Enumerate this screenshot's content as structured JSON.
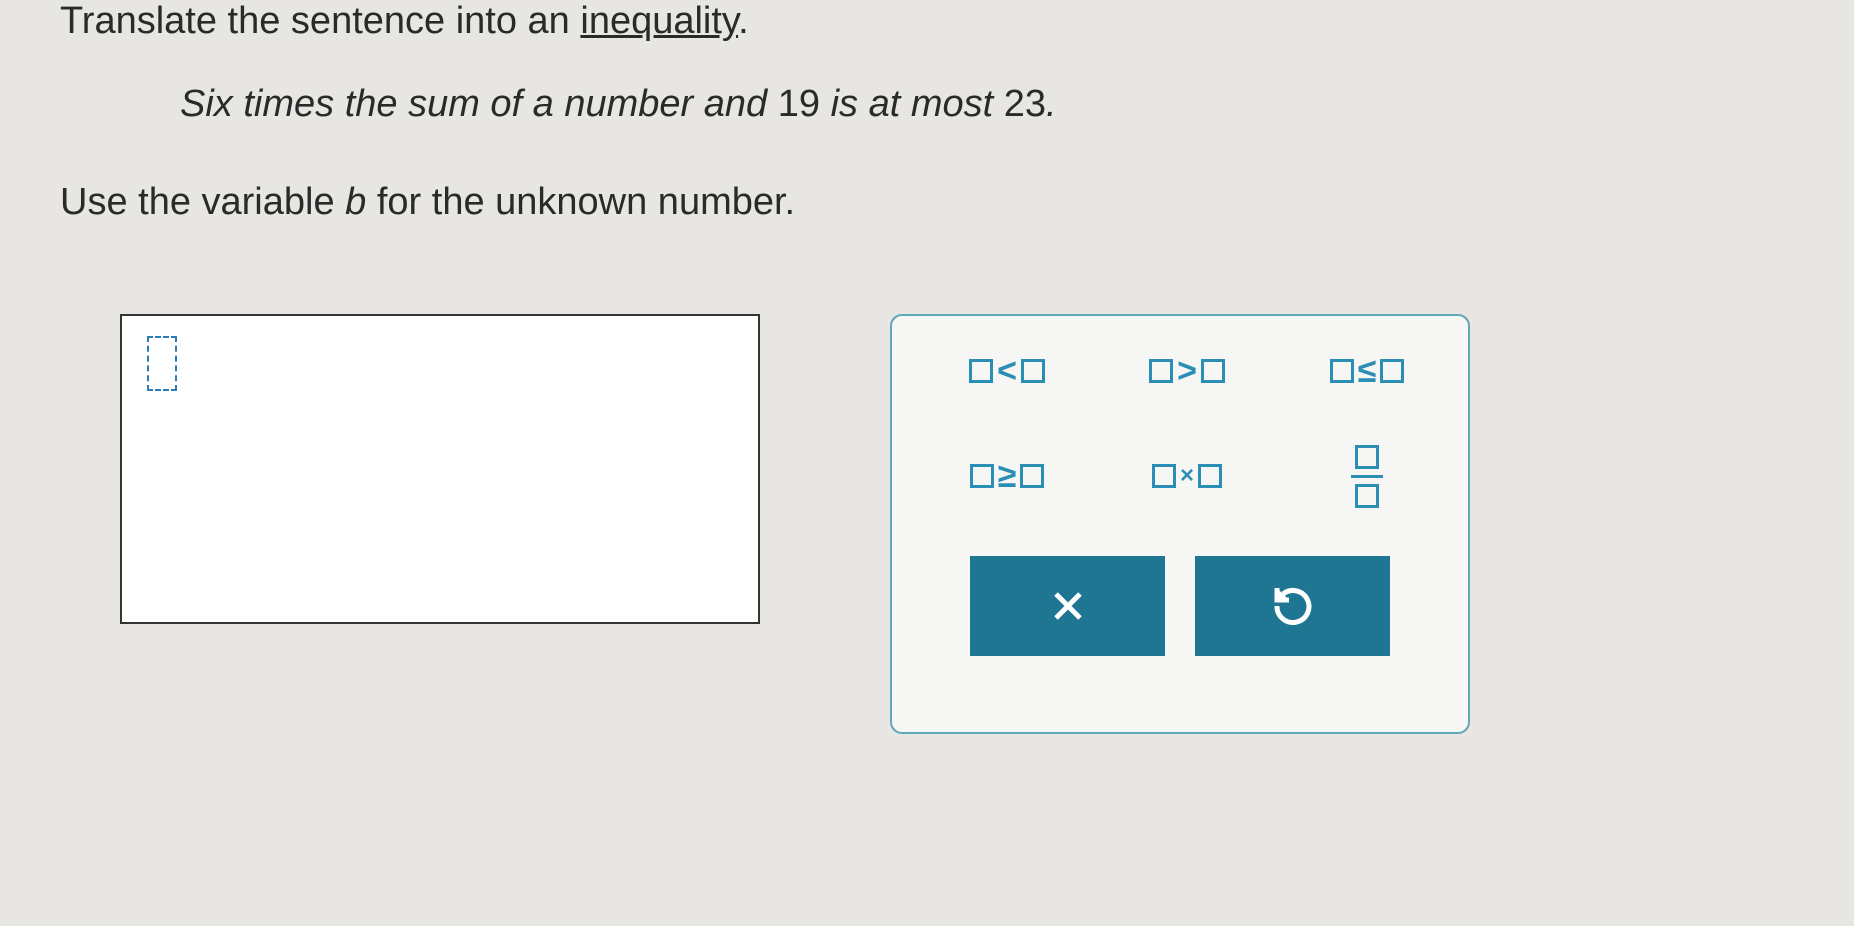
{
  "instruction": {
    "prefix": "Translate the sentence into an ",
    "link": "inequality",
    "suffix": "."
  },
  "problem": {
    "prefix": "Six times the sum of a number and ",
    "num1": "19",
    "mid": " is at most ",
    "num2": "23",
    "suffix": "."
  },
  "variable_instruction": {
    "prefix": "Use the variable ",
    "var": "b",
    "suffix": " for the unknown number."
  },
  "symbols": {
    "lt": "<",
    "gt": ">",
    "le": "≤",
    "ge": "≥",
    "times": "×"
  },
  "actions": {
    "clear": "X",
    "reset": "↺"
  }
}
